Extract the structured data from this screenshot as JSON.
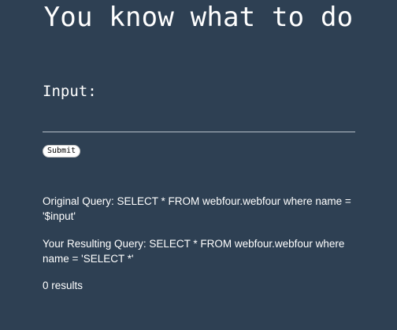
{
  "heading": "You know what to do",
  "form": {
    "label": "Input:",
    "input_value": "",
    "input_placeholder": "",
    "submit_label": "Submit"
  },
  "results": {
    "original_query": "Original Query: SELECT * FROM webfour.webfour where name = '$input'",
    "resulting_query": "Your Resulting Query: SELECT * FROM webfour.webfour where name = 'SELECT *'",
    "result_count": "0 results"
  },
  "colors": {
    "background": "#2e4053",
    "text": "#ffffff",
    "input_underline": "#b7c0c9"
  }
}
